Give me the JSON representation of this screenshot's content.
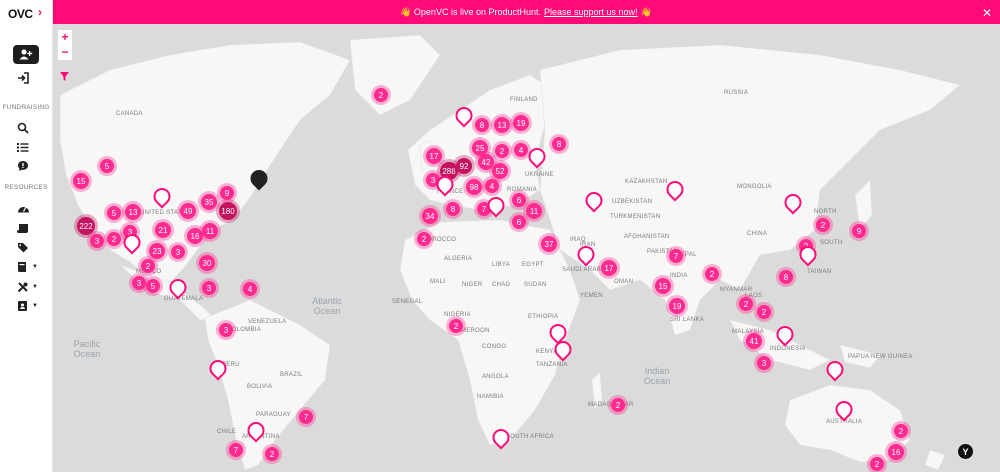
{
  "app": {
    "logo_text": "OVC"
  },
  "banner": {
    "text": "👋 OpenVC is live on ProductHunt.",
    "link": "Please support us now!",
    "wave": "👋",
    "close": "✕"
  },
  "sidebar": {
    "sections": [
      {
        "label": "FUNDRAISING"
      },
      {
        "label": "RESOURCES"
      }
    ]
  },
  "map": {
    "zoom_in": "+",
    "zoom_out": "−",
    "country_labels": [
      "CANADA",
      "UNITED STATES",
      "MEXICO",
      "GUATEMALA",
      "VENEZUELA",
      "COLOMBIA",
      "PERU",
      "BOLIVIA",
      "BRAZIL",
      "PARAGUAY",
      "ARGENTINA",
      "CHILE",
      "FINLAND",
      "UKRAINE",
      "RUSSIA",
      "KAZAKHSTAN",
      "MONGOLIA",
      "CHINA",
      "NORTH",
      "SOUTH",
      "TAIWAN",
      "TURKMENISTAN",
      "UZBEKISTAN",
      "AFGHANISTAN",
      "IRAN",
      "IRAQ",
      "SAUDI ARABIA",
      "YEMEN",
      "OMAN",
      "PAKISTAN",
      "INDIA",
      "NEPAL",
      "MYANMAR",
      "LAOS",
      "SRI LANKA",
      "MALAYSIA",
      "INDONESIA",
      "PAPUA NEW GUINEA",
      "AUSTRALIA",
      "ALGERIA",
      "LIBYA",
      "EGYPT",
      "MALI",
      "NIGER",
      "CHAD",
      "SUDAN",
      "SENEGAL",
      "NIGERIA",
      "CAMEROON",
      "ETHIOPIA",
      "CONGO",
      "KENYA",
      "TANZANIA",
      "ANGOLA",
      "NAMIBIA",
      "SOUTH AFRICA",
      "MADAGASCAR",
      "MOROCCO",
      "ROMANIA",
      "FRANCE"
    ],
    "oceans": [
      "Atlantic Ocean",
      "Pacific Ocean",
      "Indian Ocean"
    ],
    "clusters": [
      "2",
      "5",
      "15",
      "5",
      "13",
      "3",
      "222",
      "3",
      "2",
      "21",
      "23",
      "3",
      "2",
      "3",
      "5",
      "49",
      "35",
      "180",
      "16",
      "11",
      "9",
      "30",
      "4",
      "3",
      "3",
      "7",
      "2",
      "7",
      "8",
      "13",
      "19",
      "17",
      "25",
      "42",
      "2",
      "4",
      "52",
      "288",
      "92",
      "98",
      "4",
      "6",
      "11",
      "6",
      "8",
      "34",
      "2",
      "7",
      "37",
      "17",
      "7",
      "2",
      "15",
      "19",
      "2",
      "8",
      "2",
      "2",
      "41",
      "2",
      "3",
      "2",
      "9",
      "2",
      "2",
      "2",
      "16",
      "8",
      "3"
    ],
    "badge": "Y"
  },
  "colors": {
    "accent": "#ff0a78",
    "cluster": "#ff2a8f",
    "cluster_dark": "#c4135f",
    "land": "#f7f7f7",
    "water": "#dbdbdb"
  }
}
